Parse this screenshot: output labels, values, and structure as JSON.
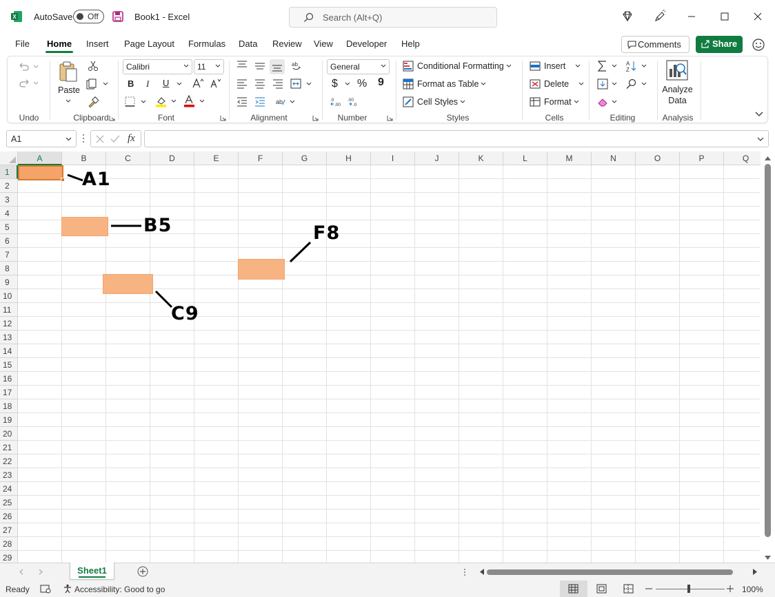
{
  "window": {
    "autosave_label": "AutoSave",
    "autosave_state": "Off",
    "doc_title": "Book1  -  Excel",
    "search_placeholder": "Search (Alt+Q)"
  },
  "menu": {
    "items": [
      "File",
      "Home",
      "Insert",
      "Page Layout",
      "Formulas",
      "Data",
      "Review",
      "View",
      "Developer",
      "Help"
    ],
    "active": "Home",
    "comments_label": "Comments",
    "share_label": "Share"
  },
  "ribbon": {
    "groups": {
      "undo": "Undo",
      "clipboard": "Clipboard",
      "font": "Font",
      "alignment": "Alignment",
      "number": "Number",
      "styles": "Styles",
      "cells": "Cells",
      "editing": "Editing",
      "analysis": "Analysis"
    },
    "paste_label": "Paste",
    "font_name": "Calibri",
    "font_size": "11",
    "number_format": "General",
    "styles": {
      "conditional": "Conditional Formatting",
      "table": "Format as Table",
      "cell_styles": "Cell Styles"
    },
    "cells": {
      "insert": "Insert",
      "delete": "Delete",
      "format": "Format"
    },
    "analyze_line1": "Analyze",
    "analyze_line2": "Data",
    "bold": "B",
    "italic": "I",
    "underline": "U",
    "percent": "%",
    "dollar": "$",
    "comma": "9"
  },
  "formula_bar": {
    "name_box": "A1",
    "fx": "fx",
    "content": ""
  },
  "grid": {
    "columns": [
      "A",
      "B",
      "C",
      "D",
      "E",
      "F",
      "G",
      "H",
      "I",
      "J",
      "K",
      "L",
      "M",
      "N",
      "O",
      "P",
      "Q"
    ],
    "rows": [
      "1",
      "2",
      "3",
      "4",
      "5",
      "6",
      "7",
      "8",
      "9",
      "10",
      "11",
      "12",
      "13",
      "14",
      "15",
      "16",
      "17",
      "18",
      "19",
      "20",
      "21",
      "22",
      "23",
      "24",
      "25",
      "26",
      "27",
      "28",
      "29"
    ],
    "selected_cell": "A1",
    "highlight_color": "#f8b382",
    "callouts": [
      "A1",
      "B5",
      "C9",
      "F8"
    ]
  },
  "sheets": {
    "tabs": [
      "Sheet1"
    ],
    "active": "Sheet1"
  },
  "status": {
    "mode": "Ready",
    "accessibility": "Accessibility: Good to go",
    "zoom": "100%"
  },
  "colors": {
    "excel_green": "#107c41",
    "accent": "#f8b382"
  }
}
